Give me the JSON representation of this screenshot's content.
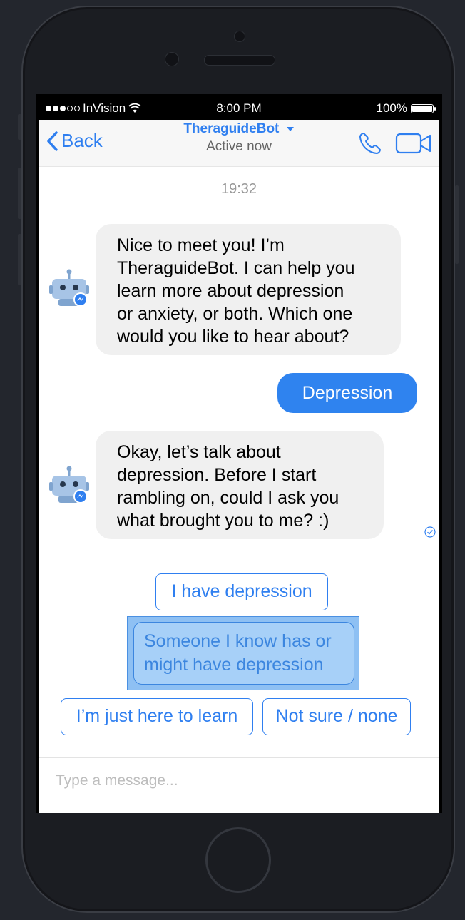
{
  "status_bar": {
    "carrier": "InVision",
    "time": "8:00 PM",
    "battery": "100%"
  },
  "header": {
    "back_label": "Back",
    "title": "TheraguideBot",
    "subtitle": "Active now",
    "icons": [
      "chevron-left-icon",
      "dropdown-caret-icon",
      "phone-icon",
      "video-camera-icon"
    ]
  },
  "conversation": {
    "timestamp": "19:32",
    "messages": [
      {
        "from": "bot",
        "lines": [
          "Nice to meet you! I’m",
          "TheraguideBot. I can help you",
          "learn more about depression",
          "or anxiety, or both. Which one",
          "would you like to hear about?"
        ]
      },
      {
        "from": "user",
        "text": "Depression"
      },
      {
        "from": "bot",
        "lines": [
          "Okay, let’s talk about",
          "depression. Before I start",
          "rambling on, could I ask you",
          "what brought you to me? :)"
        ]
      }
    ]
  },
  "quick_replies": [
    {
      "label": "I have depression",
      "selected": false
    },
    {
      "label_lines": [
        "Someone I know has or",
        "might have depression"
      ],
      "selected": true
    },
    {
      "label": "I’m just here to learn",
      "selected": false
    },
    {
      "label": "Not sure / none",
      "selected": false
    }
  ],
  "composer": {
    "placeholder": "Type a message..."
  },
  "colors": {
    "accent": "#2f7ff0",
    "user_bubble": "#2f83ef",
    "bot_bubble": "#f0f0f0",
    "selected_reply_bg": "#a7d0f8",
    "device_body": "#1b1d22",
    "background": "#23262d"
  }
}
